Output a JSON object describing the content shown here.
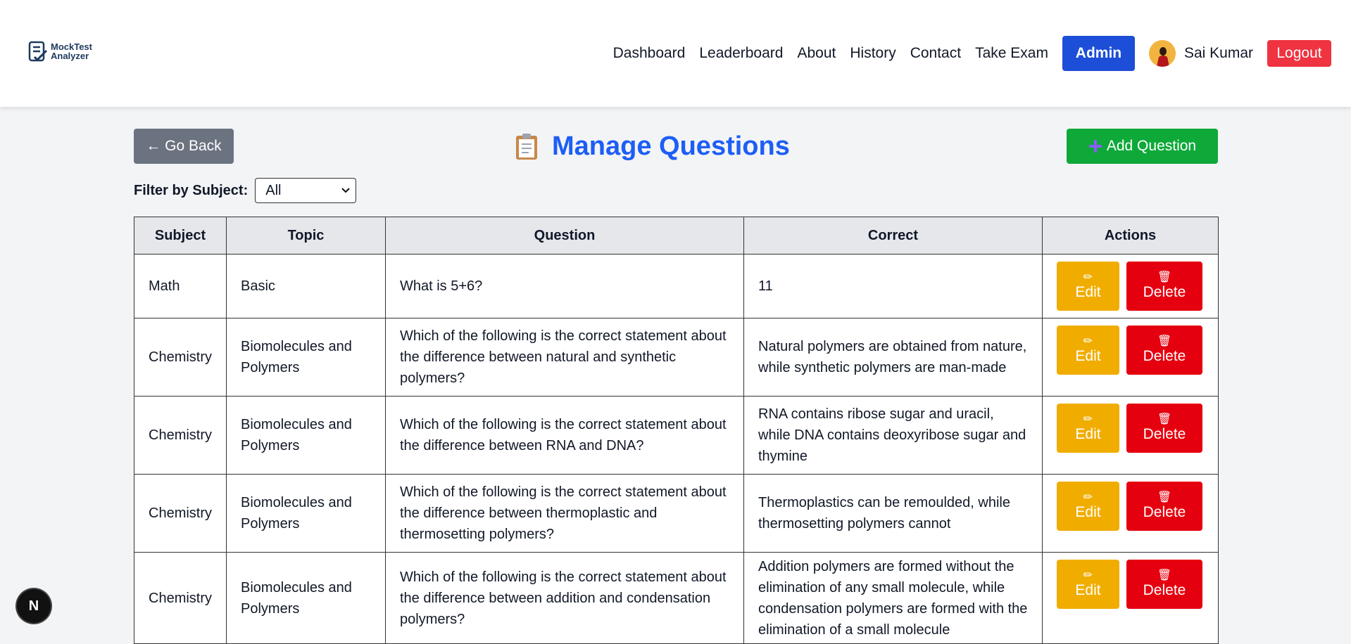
{
  "brand": {
    "line1": "MockTest",
    "line2": "Analyzer"
  },
  "nav": {
    "links": [
      "Dashboard",
      "Leaderboard",
      "About",
      "History",
      "Contact",
      "Take Exam"
    ],
    "admin_label": "Admin",
    "user_name": "Sai Kumar",
    "logout_label": "Logout"
  },
  "toolbar": {
    "go_back_label": "← Go Back",
    "title": "Manage Questions",
    "title_icon": "clipboard-icon",
    "add_label": "Add Question",
    "add_icon": "plus-icon"
  },
  "filter": {
    "label": "Filter by Subject:",
    "selected": "All"
  },
  "table": {
    "headers": [
      "Subject",
      "Topic",
      "Question",
      "Correct",
      "Actions"
    ],
    "edit_label": "Edit",
    "delete_label": "Delete",
    "rows": [
      {
        "subject": "Math",
        "topic": "Basic",
        "question": "What is 5+6?",
        "correct": "11"
      },
      {
        "subject": "Chemistry",
        "topic": "Biomolecules and Polymers",
        "question": "Which of the following is the correct statement about the difference between natural and synthetic polymers?",
        "correct": "Natural polymers are obtained from nature, while synthetic polymers are man-made"
      },
      {
        "subject": "Chemistry",
        "topic": "Biomolecules and Polymers",
        "question": "Which of the following is the correct statement about the difference between RNA and DNA?",
        "correct": "RNA contains ribose sugar and uracil, while DNA contains deoxyribose sugar and thymine"
      },
      {
        "subject": "Chemistry",
        "topic": "Biomolecules and Polymers",
        "question": "Which of the following is the correct statement about the difference between thermoplastic and thermosetting polymers?",
        "correct": "Thermoplastics can be remoulded, while thermosetting polymers cannot"
      },
      {
        "subject": "Chemistry",
        "topic": "Biomolecules and Polymers",
        "question": "Which of the following is the correct statement about the difference between addition and condensation polymers?",
        "correct": "Addition polymers are formed without the elimination of any small molecule, while condensation polymers are formed with the elimination of a small molecule"
      }
    ]
  },
  "dev_badge": "N"
}
